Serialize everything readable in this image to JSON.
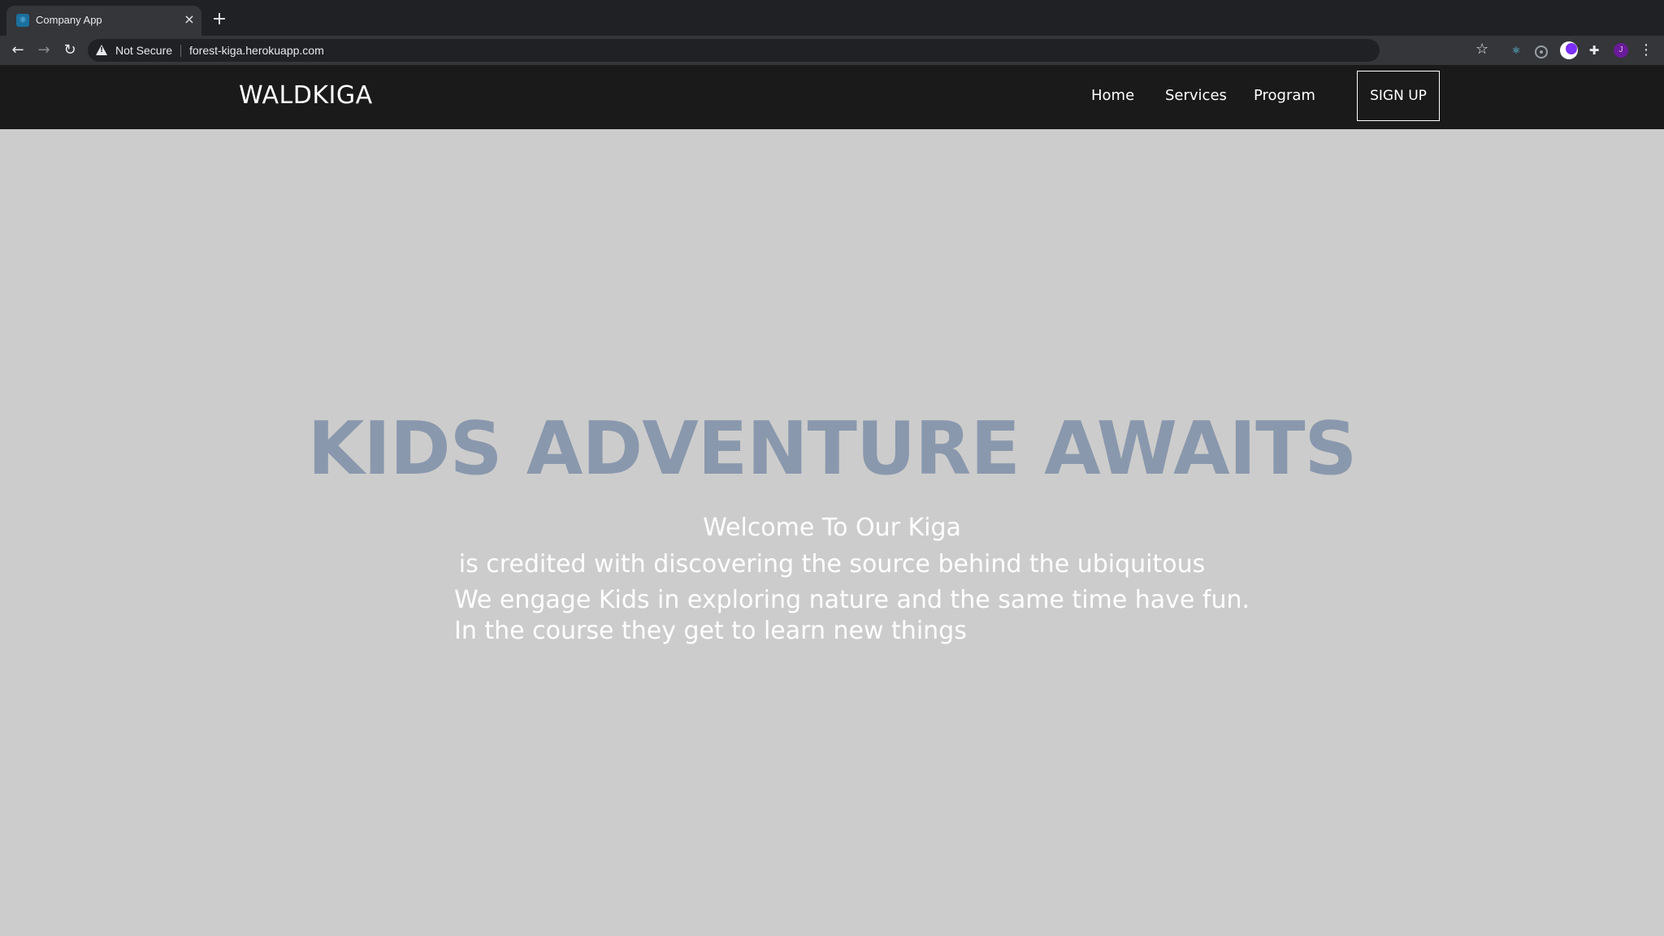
{
  "browser": {
    "tab_title": "Company App",
    "security_label": "Not Secure",
    "url": "forest-kiga.herokuapp.com",
    "profile_initial": "J"
  },
  "site": {
    "logo": "WALDKIGA",
    "nav": {
      "home": "Home",
      "services": "Services",
      "program": "Program",
      "signup": "SIGN UP"
    },
    "hero": {
      "title": "KIDS ADVENTURE AWAITS",
      "welcome": "Welcome To Our Kiga",
      "line2": "is credited with discovering the source behind the ubiquitous",
      "line3": "We engage Kids in exploring nature and the same time have fun.",
      "line4": "In the course they get to learn new things"
    },
    "colors": {
      "nav_bg": "#1a1a1a",
      "page_bg": "#cccccc",
      "hero_title": "#8a98ad"
    }
  }
}
